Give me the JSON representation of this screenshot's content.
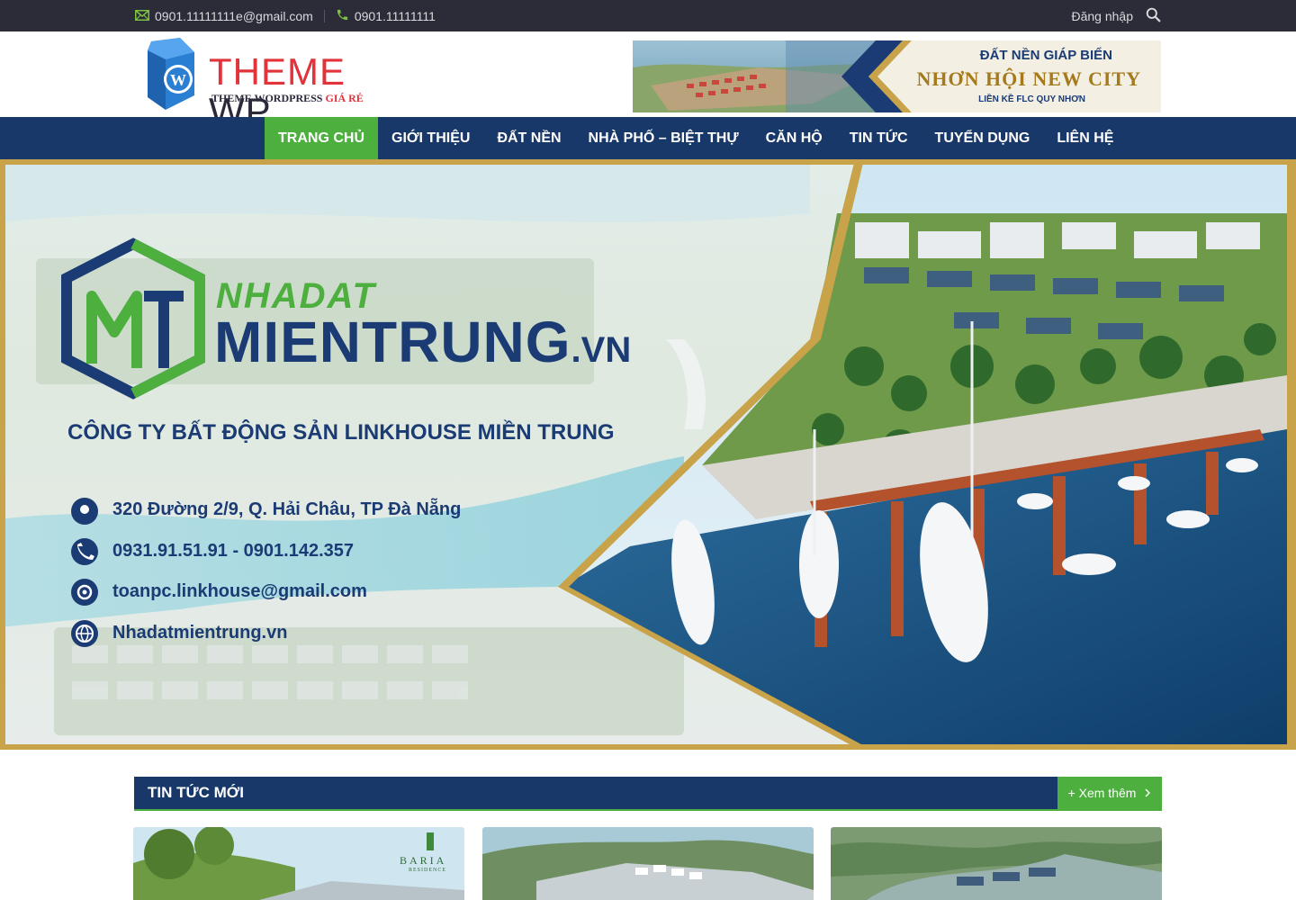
{
  "topbar": {
    "email": "0901.11111111e@gmail.com",
    "phone": "0901.11111111",
    "login": "Đăng nhập",
    "icons": {
      "email": "mail-icon",
      "phone": "phone-icon",
      "search": "search-icon"
    },
    "icon_color": "#7cc242"
  },
  "header": {
    "logo_main": "THEME",
    "logo_wp": "WP",
    "logo_sub": "THEME WORDPRESS",
    "logo_sub_red": "GIÁ RẺ",
    "ad": {
      "line1": "ĐẤT  NỀN GIÁP BIỂN",
      "line2": "NHƠN HỘI NEW CITY",
      "line3": "LIỀN KỀ FLC QUY NHƠN"
    }
  },
  "nav": {
    "items": [
      {
        "label": "TRANG CHỦ",
        "active": true
      },
      {
        "label": "GIỚI THIỆU"
      },
      {
        "label": "ĐẤT NỀN"
      },
      {
        "label": "NHÀ PHỐ – BIỆT THỰ"
      },
      {
        "label": "CĂN HỘ"
      },
      {
        "label": "TIN TỨC"
      },
      {
        "label": "TUYỂN DỤNG"
      },
      {
        "label": "LIÊN HỆ"
      }
    ]
  },
  "hero": {
    "brand_top": "NHADAT",
    "brand_main": "MIENTRUNG",
    "brand_suffix": ".VN",
    "company": "CÔNG TY BẤT ĐỘNG SẢN LINKHOUSE MIỀN TRUNG",
    "address": "320 Đường 2/9, Q. Hải Châu, TP Đà Nẵng",
    "phones": "0931.91.51.91 - 0901.142.357",
    "email": "toanpc.linkhouse@gmail.com",
    "website": "Nhadatmientrung.vn"
  },
  "news": {
    "title": "TIN TỨC MỚI",
    "more": "+ Xem thêm",
    "card1_brand": "BARIA",
    "card1_sub": "RESIDENCE"
  },
  "colors": {
    "navy": "#173868",
    "green": "#4caf3e",
    "topbar": "#2c2c38",
    "gold": "#c9a34a"
  }
}
